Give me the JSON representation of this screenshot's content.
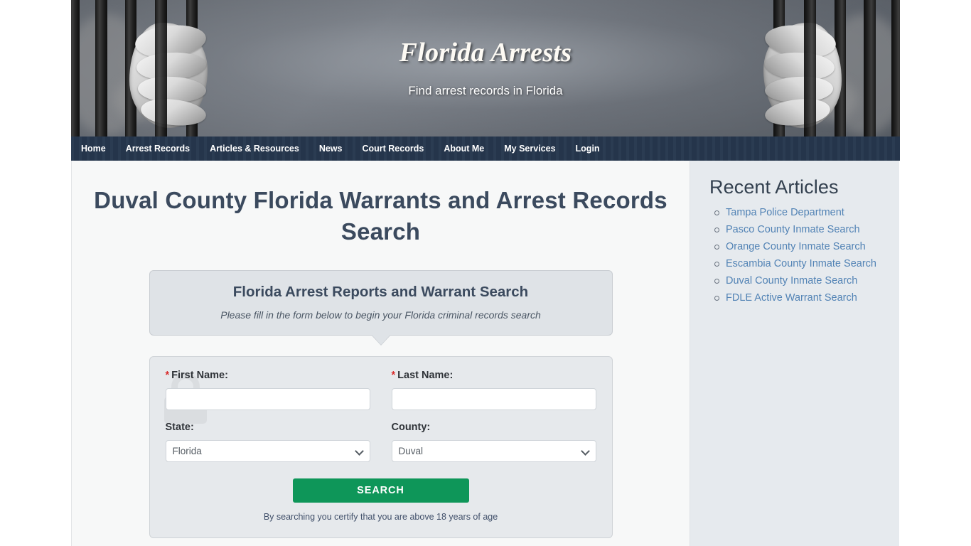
{
  "banner": {
    "title": "Florida Arrests",
    "subtitle": "Find arrest records in Florida"
  },
  "nav": {
    "items": [
      {
        "label": "Home"
      },
      {
        "label": "Arrest Records"
      },
      {
        "label": "Articles & Resources"
      },
      {
        "label": "News"
      },
      {
        "label": "Court Records"
      },
      {
        "label": "About Me"
      },
      {
        "label": "My Services"
      },
      {
        "label": "Login"
      }
    ]
  },
  "main": {
    "page_title": "Duval County Florida Warrants and Arrest Records Search",
    "callout": {
      "heading": "Florida Arrest Reports and Warrant Search",
      "text": "Please fill in the form below to begin your Florida criminal records search"
    },
    "form": {
      "required_mark": "*",
      "first_name_label": "First Name:",
      "first_name_value": "",
      "first_name_placeholder": "",
      "last_name_label": "Last Name:",
      "last_name_value": "",
      "last_name_placeholder": "",
      "state_label": "State:",
      "state_value": "Florida",
      "state_options": [
        "Florida"
      ],
      "county_label": "County:",
      "county_value": "Duval",
      "county_options": [
        "Duval"
      ],
      "search_button": "SEARCH",
      "disclaimer": "By searching you certify that you are above 18 years of age"
    }
  },
  "sidebar": {
    "heading": "Recent Articles",
    "articles": [
      {
        "label": "Tampa Police Department"
      },
      {
        "label": "Pasco County Inmate Search"
      },
      {
        "label": "Orange County Inmate Search"
      },
      {
        "label": "Escambia County Inmate Search"
      },
      {
        "label": "Duval County Inmate Search"
      },
      {
        "label": "FDLE Active Warrant Search"
      }
    ]
  },
  "colors": {
    "nav_bg": "#26374e",
    "title_text": "#3b4a5e",
    "link_blue": "#5283b5",
    "search_green": "#0e9659",
    "required_red": "#d92b2b",
    "sidebar_bg": "#e6eaee"
  }
}
